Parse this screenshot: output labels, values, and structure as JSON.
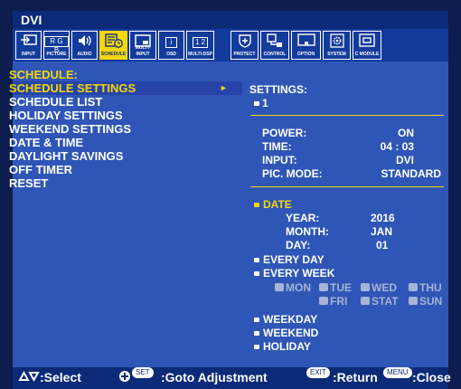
{
  "window": {
    "title": "DVI"
  },
  "tabs": [
    {
      "label": "INPUT",
      "icon": "input-icon"
    },
    {
      "label": "PICTURE",
      "icon": "picture-icon"
    },
    {
      "label": "AUDIO",
      "icon": "audio-icon"
    },
    {
      "label": "SCHEDULE",
      "icon": "schedule-icon"
    },
    {
      "label": "MULTI-INPUT",
      "icon": "multi-input-icon"
    },
    {
      "label": "OSD",
      "icon": "osd-icon"
    },
    {
      "label": "MULTI-DSP",
      "icon": "multi-dsp-icon"
    },
    {
      "label": "PROTECT",
      "icon": "protect-icon"
    },
    {
      "label": "CONTROL",
      "icon": "control-icon"
    },
    {
      "label": "OPTION",
      "icon": "option-icon"
    },
    {
      "label": "SYSTEM",
      "icon": "system-icon"
    },
    {
      "label": "C MODULE",
      "icon": "c-module-icon"
    }
  ],
  "tab_glyphs": {
    "rgb": "R G B",
    "info": "i",
    "multidsp": "1 2"
  },
  "menu": {
    "heading": "SCHEDULE:",
    "items": [
      "SCHEDULE SETTINGS",
      "SCHEDULE LIST",
      "HOLIDAY SETTINGS",
      "WEEKEND SETTINGS",
      "DATE & TIME",
      "DAYLIGHT SAVINGS",
      "OFF TIMER",
      "RESET"
    ],
    "selected_arrow": "►"
  },
  "settings": {
    "heading": "SETTINGS:",
    "number": "1",
    "power_label": "POWER:",
    "power_value": "ON",
    "time_label": "TIME:",
    "time_value": "04 : 03",
    "input_label": "INPUT:",
    "input_value": "DVI",
    "picmode_label": "PIC. MODE:",
    "picmode_value": "STANDARD"
  },
  "date": {
    "label": "DATE",
    "year_label": "YEAR:",
    "year_value": "2016",
    "month_label": "MONTH:",
    "month_value": "JAN",
    "day_label": "DAY:",
    "day_value": "01"
  },
  "repeat": {
    "every_day": "EVERY DAY",
    "every_week": "EVERY WEEK",
    "days": [
      "MON",
      "TUE",
      "WED",
      "THU",
      "FRI",
      "STAT",
      "SUN"
    ],
    "weekday": "WEEKDAY",
    "weekend": "WEEKEND",
    "holiday": "HOLIDAY"
  },
  "footer": {
    "select": ":Select",
    "set_key": "SET",
    "goto": ":Goto Adjustment",
    "exit_key": "EXIT",
    "return": ":Return",
    "menu_key": "MENU",
    "close": ":Close"
  },
  "colors": {
    "accent": "#f5d70a",
    "panel": "#2f56b6",
    "bar": "#0b2a78",
    "background": "#0d1d4d"
  }
}
